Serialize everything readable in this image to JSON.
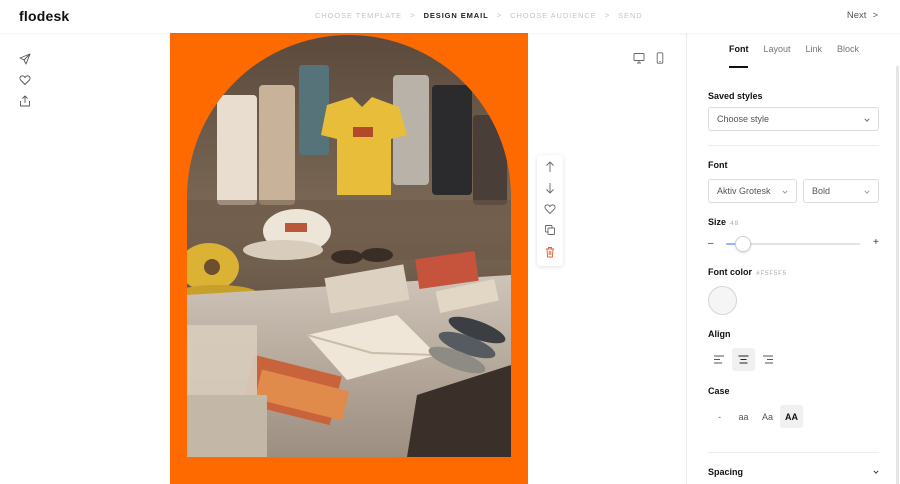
{
  "app": {
    "logo": "flodesk"
  },
  "steps": [
    "CHOOSE TEMPLATE",
    "DESIGN EMAIL",
    "CHOOSE AUDIENCE",
    "SEND"
  ],
  "active_step": "DESIGN EMAIL",
  "header": {
    "next_label": "Next",
    "next_arrow": ">"
  },
  "panel": {
    "tabs": [
      "Font",
      "Layout",
      "Link",
      "Block"
    ],
    "active_tab": "Font",
    "saved_styles": {
      "label": "Saved styles",
      "placeholder": "Choose style"
    },
    "font": {
      "label": "Font",
      "family": "Aktiv Grotesk",
      "weight": "Bold"
    },
    "size": {
      "label": "Size",
      "value": "48",
      "minus": "–",
      "plus": "+",
      "level_fraction": 0.13
    },
    "font_color": {
      "label": "Font color",
      "hex": "#F5F5F5",
      "color": "#f5f5f5"
    },
    "align": {
      "label": "Align",
      "options": [
        "left",
        "center",
        "right"
      ],
      "selected": "center"
    },
    "case": {
      "label": "Case",
      "options": [
        "-",
        "aa",
        "Aa",
        "AA"
      ],
      "selected": "AA"
    },
    "spacing": {
      "label": "Spacing"
    }
  },
  "colors": {
    "canvas_bg": "#ff6a00",
    "accent": "#9bb6ff"
  },
  "icons": {
    "left_rail": [
      "send-icon",
      "heart-icon",
      "share-icon"
    ],
    "devices": [
      "desktop-icon",
      "mobile-icon"
    ],
    "toolbox": [
      "arrow-up-icon",
      "arrow-down-icon",
      "heart-icon",
      "duplicate-icon",
      "trash-icon"
    ]
  }
}
